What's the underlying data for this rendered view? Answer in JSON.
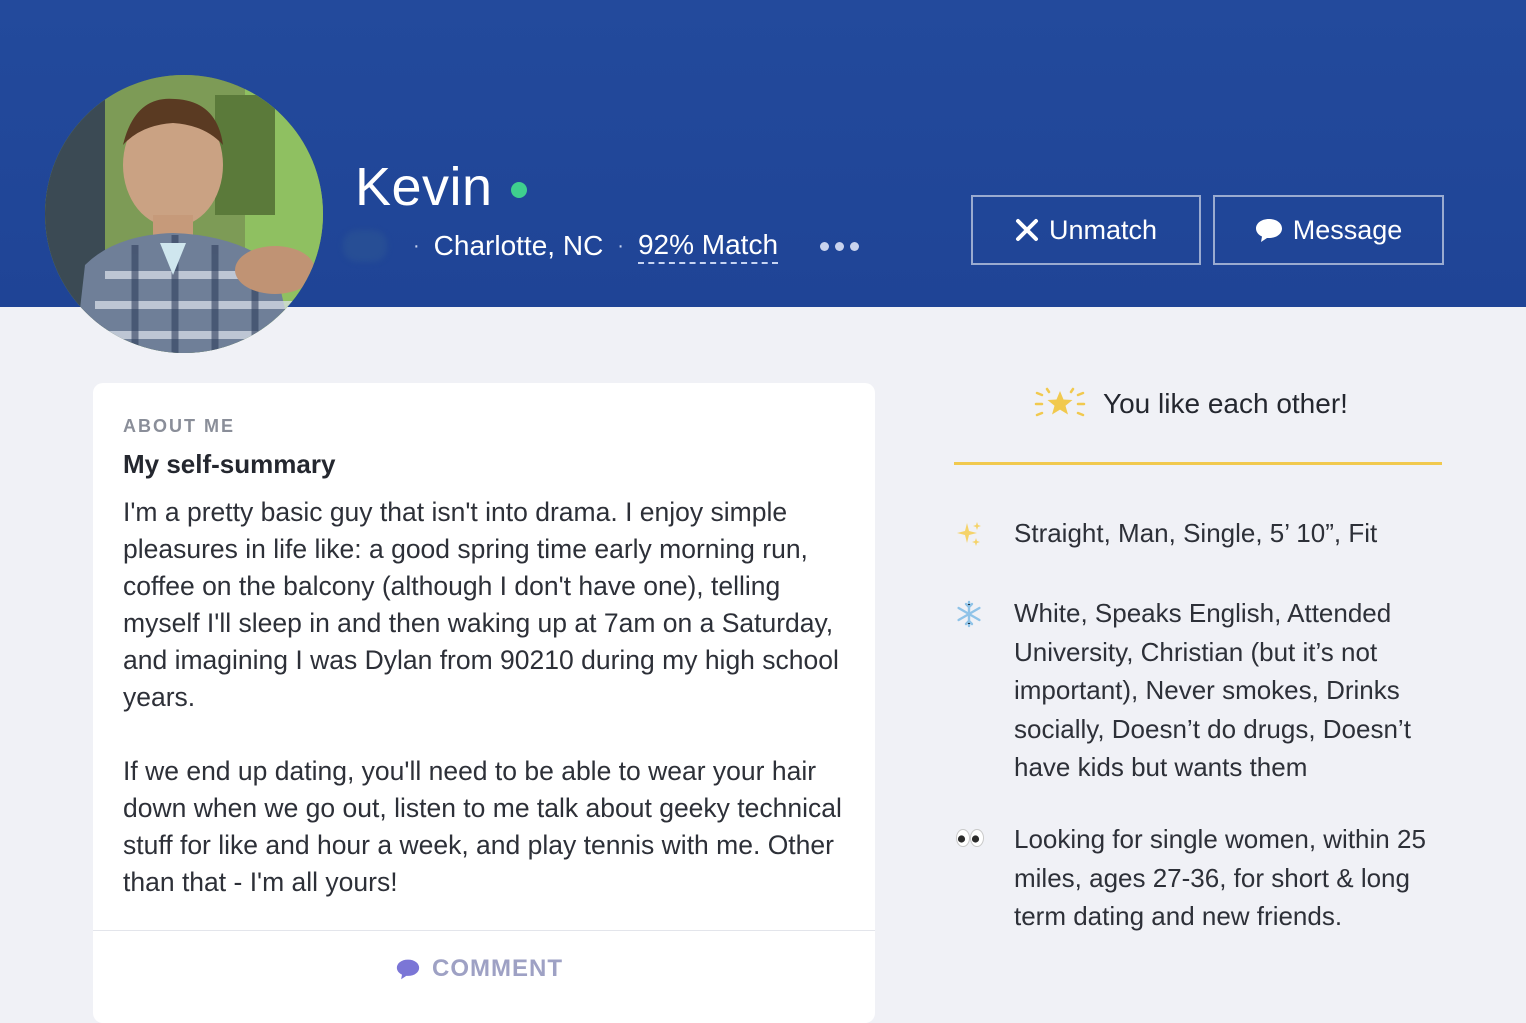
{
  "profile": {
    "name": "Kevin",
    "location": "Charlotte, NC",
    "match": "92% Match",
    "separator": "·"
  },
  "actions": {
    "unmatch_label": "Unmatch",
    "message_label": "Message"
  },
  "about": {
    "section_label": "ABOUT ME",
    "title": "My self-summary",
    "paragraph_1": "I'm a pretty basic guy that isn't into drama. I enjoy simple pleasures in life like: a good spring time early morning run, coffee on the balcony (although I don't have one), telling myself I'll sleep in and then waking up at 7am on a Saturday, and imagining I was Dylan from 90210 during my high school years.",
    "paragraph_2": "If we end up dating, you'll need to be able to wear your hair down when we go out, listen to me talk about geeky technical stuff for like and hour a week, and play tennis with me. Other than that - I'm all yours!",
    "comment_label": "COMMENT"
  },
  "mutual": {
    "text": "You like each other!",
    "icon": "sparkle-star-icon",
    "accent_color": "#f1c94e"
  },
  "details": [
    {
      "icon": "sparkles-icon",
      "text": "Straight, Man, Single, 5’ 10”, Fit"
    },
    {
      "icon": "snowflake-icon",
      "text": "White, Speaks English, Attended University, Christian (but it’s not important), Never smokes, Drinks socially, Doesn’t do drugs, Doesn’t have kids but wants them"
    },
    {
      "icon": "eyes-icon",
      "text": "Looking for single women, within 25 miles, ages 27-36, for short & long term dating and new friends."
    }
  ],
  "colors": {
    "header_blue": "#234a9c",
    "online_green": "#3fcf8e",
    "page_bg": "#f0f1f6"
  }
}
